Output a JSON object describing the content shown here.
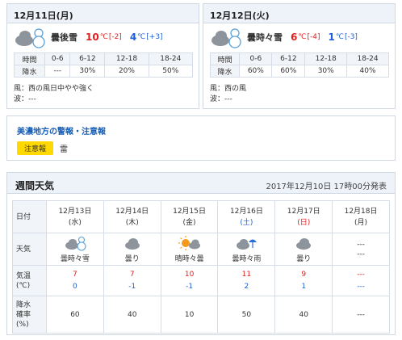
{
  "today": {
    "title": "12月11日(月)",
    "desc": "曇後雪",
    "hi": "10",
    "hi_unit": "℃",
    "hi_diff": "[-2]",
    "lo": "4",
    "lo_unit": "℃",
    "lo_diff": "[+3]",
    "icon": "cloud-then-snowman-icon",
    "precip_head": [
      "時間",
      "0-6",
      "6-12",
      "12-18",
      "18-24"
    ],
    "precip_vals": [
      "降水",
      "---",
      "30%",
      "20%",
      "50%"
    ],
    "wind": "風：西の風日中やや強く",
    "wave": "波：---"
  },
  "tomorrow": {
    "title": "12月12日(火)",
    "desc": "曇時々雪",
    "hi": "6",
    "hi_unit": "℃",
    "hi_diff": "[-4]",
    "lo": "1",
    "lo_unit": "℃",
    "lo_diff": "[-3]",
    "icon": "cloud-sometimes-snowman-icon",
    "precip_head": [
      "時間",
      "0-6",
      "6-12",
      "12-18",
      "18-24"
    ],
    "precip_vals": [
      "降水",
      "60%",
      "60%",
      "30%",
      "40%"
    ],
    "wind": "風：西の風",
    "wave": "波：---"
  },
  "warning": {
    "title": "美濃地方の警報・注意報",
    "badge": "注意報",
    "item": "雷"
  },
  "weekly": {
    "title": "週間天気",
    "announced": "2017年12月10日 17時00分発表",
    "labels": {
      "date": "日付",
      "weather": "天気",
      "temp_1": "気温",
      "temp_2": "(℃)",
      "rain_1": "降水",
      "rain_2": "確率",
      "rain_3": "(%)"
    },
    "days": [
      {
        "date": "12月13日",
        "dow": "(水)",
        "dow_type": "weekday",
        "wx": "曇時々雪",
        "icon": "cloud-snowman-icon",
        "hi": "7",
        "lo": "0",
        "rain": "60"
      },
      {
        "date": "12月14日",
        "dow": "(木)",
        "dow_type": "weekday",
        "wx": "曇り",
        "icon": "cloud-icon",
        "hi": "7",
        "lo": "-1",
        "rain": "40"
      },
      {
        "date": "12月15日",
        "dow": "(金)",
        "dow_type": "weekday",
        "wx": "晴時々曇",
        "icon": "sun-cloud-icon",
        "hi": "10",
        "lo": "-1",
        "rain": "10"
      },
      {
        "date": "12月16日",
        "dow": "(土)",
        "dow_type": "sat",
        "wx": "曇時々雨",
        "icon": "cloud-umbrella-icon",
        "hi": "11",
        "lo": "2",
        "rain": "50"
      },
      {
        "date": "12月17日",
        "dow": "(日)",
        "dow_type": "sun",
        "wx": "曇り",
        "icon": "cloud-icon",
        "hi": "9",
        "lo": "1",
        "rain": "40"
      },
      {
        "date": "12月18日",
        "dow": "(月)",
        "dow_type": "weekday",
        "wx": "---",
        "wx2": "---",
        "icon": "",
        "hi": "---",
        "lo": "---",
        "rain": "---"
      }
    ]
  },
  "colors": {
    "hi": "#e02020",
    "lo": "#1f5fd6",
    "badge": "#ffd800",
    "link": "#1a5fb4"
  }
}
